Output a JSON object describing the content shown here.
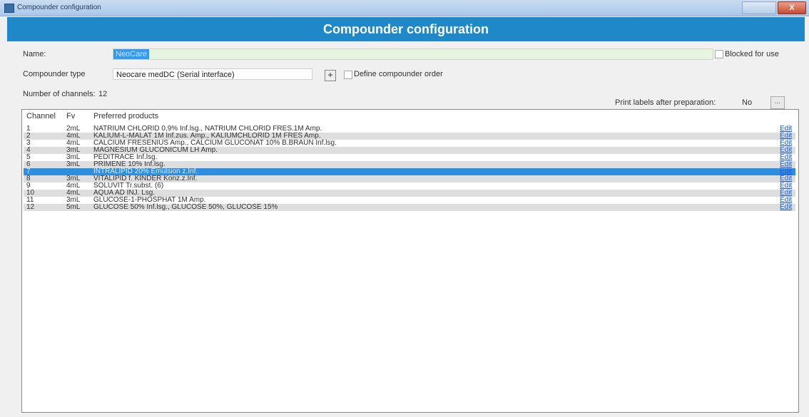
{
  "window": {
    "title": "Compounder configuration",
    "close": "X"
  },
  "header": {
    "title": "Compounder configuration"
  },
  "form": {
    "name_label": "Name:",
    "name_value": "NeoCare",
    "blocked_label": "Blocked for use",
    "type_label": "Compounder type",
    "type_value": "Neocare medDC (Serial interface)",
    "plus": "+",
    "define_order_label": "Define compounder order",
    "channels_label": "Number of channels:",
    "channels_value": "12",
    "print_label": "Print labels after preparation:",
    "print_value": "No",
    "print_button": "..."
  },
  "table": {
    "columns": [
      "Channel",
      "Fv",
      "Preferred products"
    ],
    "rows": [
      {
        "channel": "1",
        "fv": "2mL",
        "products": "NATRIUM CHLORID 0,9% Inf.lsg., NATRIUM CHLORID FRES.1M Amp.",
        "edit": "Edit"
      },
      {
        "channel": "2",
        "fv": "4mL",
        "products": "KALIUM-L-MALAT 1M Inf.zus. Amp., KALIUMCHLORID 1M FRES Amp.",
        "edit": "Edit"
      },
      {
        "channel": "3",
        "fv": "4mL",
        "products": "CALCIUM FRESENIUS Amp., CALCIUM GLUCONAT 10% B.BRAUN Inf.lsg.",
        "edit": "Edit"
      },
      {
        "channel": "4",
        "fv": "3mL",
        "products": "MAGNESIUM GLUCONICUM LH Amp.",
        "edit": "Edit"
      },
      {
        "channel": "5",
        "fv": "3mL",
        "products": "PEDITRACE Inf.lsg.",
        "edit": "Edit"
      },
      {
        "channel": "6",
        "fv": "3mL",
        "products": "PRIMENE 10% Inf.lsg.",
        "edit": "Edit"
      },
      {
        "channel": "7",
        "fv": "",
        "products": "INTRALIPID 20% Emulsion z.Inf.",
        "edit": "Edit"
      },
      {
        "channel": "8",
        "fv": "3mL",
        "products": "VITALIPID f. KINDER Konz.z.Inf.",
        "edit": "Edit"
      },
      {
        "channel": "9",
        "fv": "4mL",
        "products": "SOLUVIT Tr.subst. (6)",
        "edit": "Edit"
      },
      {
        "channel": "10",
        "fv": "4mL",
        "products": "AQUA AD INJ. Lsg.",
        "edit": "Edit"
      },
      {
        "channel": "11",
        "fv": "3mL",
        "products": "GLUCOSE-1-PHOSPHAT 1M Amp.",
        "edit": "Edit"
      },
      {
        "channel": "12",
        "fv": "5mL",
        "products": "GLUCOSE 50% Inf.lsg., GLUCOSE 50%, GLUCOSE 15%",
        "edit": "Edit"
      }
    ]
  },
  "colors": {
    "header": "#1f88c9",
    "selection": "#2f8ee0",
    "alt_row": "#dedede"
  }
}
